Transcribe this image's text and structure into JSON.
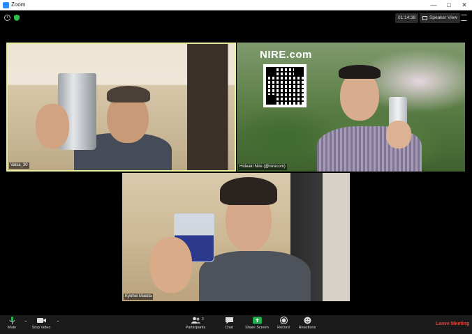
{
  "window": {
    "title": "Zoom"
  },
  "topbar": {
    "timer": "01:14:38",
    "view_label": "Speaker View"
  },
  "participants": [
    {
      "name": "Vaisa_30"
    },
    {
      "name": "Hideaki Nire (@nirecom)",
      "background_text": "NIRE.com"
    },
    {
      "name": "Kyohei Maeda"
    }
  ],
  "toolbar": {
    "mute": "Mute",
    "stop_video": "Stop Video",
    "participants": "Participants",
    "participants_count": "3",
    "chat": "Chat",
    "share_screen": "Share Screen",
    "record": "Record",
    "reactions": "Reactions",
    "leave": "Leave Meeting"
  },
  "colors": {
    "active_speaker": "#e8ef9a",
    "share_green": "#22b14c",
    "leave_red": "#e0463d",
    "zoom_blue": "#2d8cff"
  },
  "icons": [
    "zoom-app-icon",
    "info-icon",
    "shield-icon",
    "grid-icon",
    "fullscreen-icon",
    "microphone-icon",
    "camera-icon",
    "participants-icon",
    "chat-icon",
    "share-screen-icon",
    "record-icon",
    "reactions-icon"
  ]
}
